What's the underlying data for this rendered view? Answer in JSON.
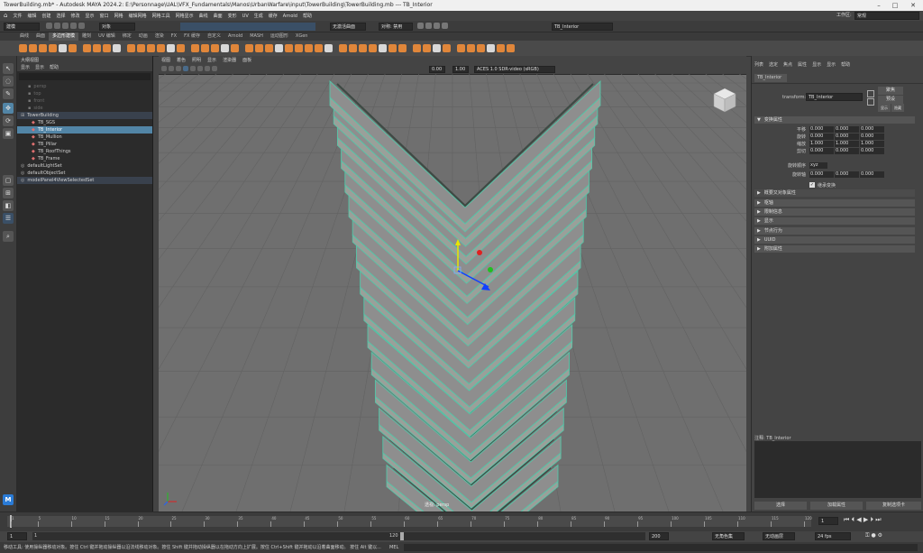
{
  "window": {
    "title": "TowerBuilding.mb* - Autodesk MAYA 2024.2: E:\\Personnage\\UAL\\VFX_Fundamentals\\Manos\\UrbanWarfare\\input\\TowerBuilding\\TowerBuilding.mb  ---  TB_Interior"
  },
  "menu": [
    "文件",
    "编辑",
    "创建",
    "选择",
    "修改",
    "显示",
    "窗口",
    "网格",
    "编辑网格",
    "网格工具",
    "网格显示",
    "曲线",
    "曲面",
    "变形",
    "UV",
    "生成",
    "缓存",
    "Arnold",
    "帮助"
  ],
  "workspace": {
    "label": "工作区:",
    "value": "常规"
  },
  "status": {
    "mode": "建模",
    "objects_menu": "对象",
    "live_surface": "无激活曲面",
    "symmetry": "对称: 禁用",
    "name_field": "TB_Interior"
  },
  "shelf_tabs": [
    "曲线",
    "曲面",
    "多边形建模",
    "雕刻",
    "UV 编辑",
    "绑定",
    "动画",
    "渲染",
    "FX",
    "FX 缓存",
    "自定义",
    "Arnold",
    "MASH",
    "运动图形",
    "XGen"
  ],
  "shelf_active": 2,
  "outliner": {
    "title": "大纲视图",
    "menu": [
      "显示",
      "显示",
      "帮助"
    ],
    "items": [
      {
        "label": "persp",
        "kind": "camera"
      },
      {
        "label": "top",
        "kind": "camera"
      },
      {
        "label": "front",
        "kind": "camera"
      },
      {
        "label": "side",
        "kind": "camera"
      },
      {
        "label": "TowerBuilding",
        "kind": "group"
      },
      {
        "label": "TB_SGS",
        "kind": "mesh"
      },
      {
        "label": "TB_Interior",
        "kind": "mesh",
        "selected": true
      },
      {
        "label": "TB_Mullion",
        "kind": "mesh"
      },
      {
        "label": "TB_Pillar",
        "kind": "mesh"
      },
      {
        "label": "TB_RoofThings",
        "kind": "mesh"
      },
      {
        "label": "TB_Frame",
        "kind": "mesh"
      },
      {
        "label": "defaultLightSet",
        "kind": "set"
      },
      {
        "label": "defaultObjectSet",
        "kind": "set"
      },
      {
        "label": "modelPanel4ViewSelectedSet",
        "kind": "set"
      }
    ]
  },
  "viewport": {
    "menu": [
      "视图",
      "着色",
      "照明",
      "显示",
      "渲染器",
      "面板"
    ],
    "exposure": "0.00",
    "gamma": "1.00",
    "color_space": "ACES 1.0 SDR-video (sRGB)",
    "camera_label": "透视: persp",
    "floors": 16
  },
  "attribute_editor": {
    "menu": [
      "列表",
      "选定",
      "焦点",
      "属性",
      "显示",
      "显示",
      "帮助"
    ],
    "tab": "TB_Interior",
    "transform_label": "transform:",
    "transform_value": "TB_Interior",
    "focus_btn": "聚焦",
    "preset_btn": "预设",
    "show_btn": "显示",
    "hide_btn": "隐藏",
    "sections": {
      "transform_attrs": "变换属性",
      "pivots": "枢轴",
      "limit": "限制信息",
      "display": "显示",
      "node_behavior": "节点行为",
      "uuid": "UUID",
      "extra": "附加属性",
      "transform_opts": "概要又对象属性"
    },
    "rows": [
      {
        "label": "平移",
        "values": [
          "0.000",
          "0.000",
          "0.000"
        ]
      },
      {
        "label": "旋转",
        "values": [
          "0.000",
          "0.000",
          "0.000"
        ]
      },
      {
        "label": "缩放",
        "values": [
          "1.000",
          "1.000",
          "1.000"
        ]
      },
      {
        "label": "剪切",
        "values": [
          "0.000",
          "0.000",
          "0.000"
        ]
      }
    ],
    "rotate_order_label": "旋转顺序",
    "rotate_order": "xyz",
    "rotate_axis_label": "旋转轴",
    "rotate_axis": [
      "0.000",
      "0.000",
      "0.000"
    ],
    "inherit": "继承变换",
    "notes_label": "注释: TB_Interior",
    "bottom_buttons": [
      "选择",
      "加载属性",
      "复制选项卡"
    ]
  },
  "timeline": {
    "ticks": [
      1,
      5,
      10,
      15,
      20,
      25,
      30,
      35,
      40,
      45,
      50,
      55,
      60,
      65,
      70,
      75,
      80,
      85,
      90,
      95,
      100,
      105,
      110,
      115,
      120
    ],
    "current_frame": "1",
    "range_start": "1",
    "range_start2": "1",
    "range_mid": "120",
    "range_end": "120",
    "range_end2": "200",
    "char_set": "无角色集",
    "anim_layer": "无动画层",
    "fps": "24 fps"
  },
  "help_line": "移动工具: 使用操纵器移动对象。按住 Ctrl 键并拖动操纵器以沿法线移动对象。按住 Shift 键并拖动操纵器以在拖动方向上扩展。按住 Ctrl+Shift 键并拖动以沿着曲面移动。  按住 Alt 键以...",
  "mel_label": "MEL",
  "colors": {
    "selection": "#5285a6",
    "wire_highlight": "#53c7a8",
    "floor_fill": "#8e8e8e",
    "viewport_bg": "#6f6f6f",
    "shelf_icon": "#e0863a"
  }
}
